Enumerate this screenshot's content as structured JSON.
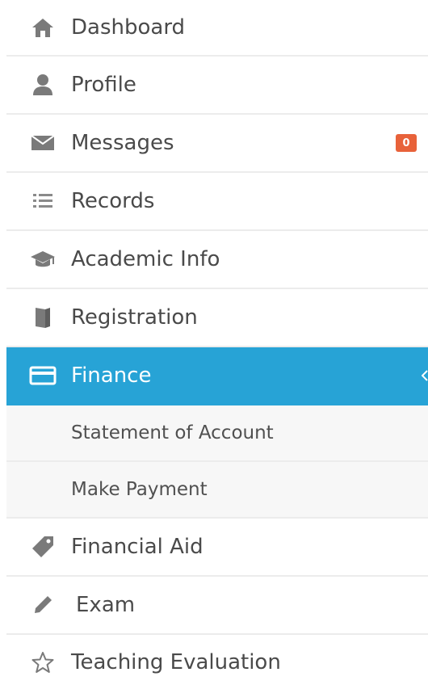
{
  "nav": {
    "dashboard": "Dashboard",
    "profile": "Profile",
    "messages": "Messages",
    "messages_badge": "0",
    "records": "Records",
    "academic_info": "Academic Info",
    "registration": "Registration",
    "finance": "Finance",
    "statement_of_account": "Statement of Account",
    "make_payment": "Make Payment",
    "financial_aid": "Financial Aid",
    "exam": "Exam",
    "teaching_evaluation": "Teaching Evaluation"
  },
  "colors": {
    "active_bg": "#27a3d6",
    "badge_bg": "#e8623a",
    "icon_gray": "#7a7a7a"
  },
  "icons": {
    "dashboard": "home-icon",
    "profile": "user-icon",
    "messages": "envelope-icon",
    "records": "list-icon",
    "academic_info": "graduation-cap-icon",
    "registration": "book-icon",
    "finance": "credit-card-icon",
    "financial_aid": "tag-icon",
    "exam": "pencil-icon",
    "teaching_evaluation": "star-icon"
  }
}
